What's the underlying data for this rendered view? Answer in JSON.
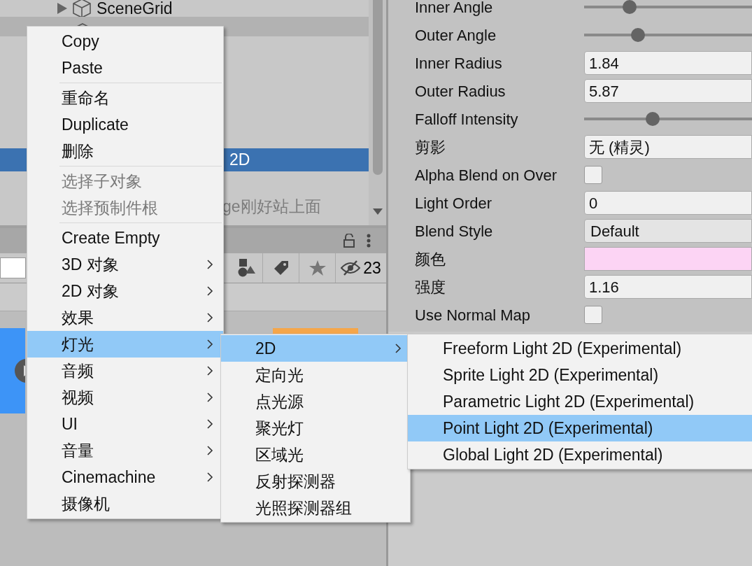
{
  "hierarchy": {
    "items": [
      {
        "name": "SceneGrid",
        "expandable": true,
        "selected": false,
        "disabled": false
      },
      {
        "expandable": false,
        "selected": false,
        "disabled": false
      },
      {
        "name": "2D",
        "expandable": false,
        "selected": true,
        "disabled": false
      },
      {
        "name": "ge刚好站上面",
        "expandable": false,
        "selected": false,
        "disabled": true
      }
    ]
  },
  "project_panel": {
    "hidden_count": "23"
  },
  "inspector": {
    "properties": [
      {
        "kind": "slider",
        "label": "Inner Angle",
        "level": 0.27
      },
      {
        "kind": "slider",
        "label": "Outer Angle",
        "level": 0.32
      },
      {
        "kind": "number",
        "label": "Inner Radius",
        "value": "1.84"
      },
      {
        "kind": "number",
        "label": "Outer Radius",
        "value": "5.87"
      },
      {
        "kind": "slider",
        "label": "Falloff Intensity",
        "level": 0.41
      },
      {
        "kind": "object",
        "label": "剪影",
        "value": "无 (精灵)"
      },
      {
        "kind": "checkbox",
        "label": "Alpha Blend on Over",
        "checked": false
      },
      {
        "kind": "number",
        "label": "Light Order",
        "value": "0"
      },
      {
        "kind": "dropdown",
        "label": "Blend Style",
        "value": "Default"
      },
      {
        "kind": "color",
        "label": "颜色",
        "color": "#fcd4f4"
      },
      {
        "kind": "number",
        "label": "强度",
        "value": "1.16"
      },
      {
        "kind": "checkbox",
        "label": "Use Normal Map",
        "checked": false
      }
    ]
  },
  "context_menu": {
    "items": [
      {
        "kind": "item",
        "label": "Copy",
        "submenu": false,
        "disabled": false,
        "selected": false
      },
      {
        "kind": "item",
        "label": "Paste",
        "submenu": false,
        "disabled": false,
        "selected": false
      },
      {
        "kind": "separator"
      },
      {
        "kind": "item",
        "label": "重命名",
        "submenu": false,
        "disabled": false,
        "selected": false
      },
      {
        "kind": "item",
        "label": "Duplicate",
        "submenu": false,
        "disabled": false,
        "selected": false
      },
      {
        "kind": "item",
        "label": "删除",
        "submenu": false,
        "disabled": false,
        "selected": false
      },
      {
        "kind": "separator"
      },
      {
        "kind": "item",
        "label": "选择子对象",
        "submenu": false,
        "disabled": true,
        "selected": false
      },
      {
        "kind": "item",
        "label": "选择预制件根",
        "submenu": false,
        "disabled": true,
        "selected": false
      },
      {
        "kind": "separator"
      },
      {
        "kind": "item",
        "label": "Create Empty",
        "submenu": false,
        "disabled": false,
        "selected": false
      },
      {
        "kind": "item",
        "label": "3D 对象",
        "submenu": true,
        "disabled": false,
        "selected": false
      },
      {
        "kind": "item",
        "label": "2D 对象",
        "submenu": true,
        "disabled": false,
        "selected": false
      },
      {
        "kind": "item",
        "label": "效果",
        "submenu": true,
        "disabled": false,
        "selected": false
      },
      {
        "kind": "item",
        "label": "灯光",
        "submenu": true,
        "disabled": false,
        "selected": true
      },
      {
        "kind": "item",
        "label": "音频",
        "submenu": true,
        "disabled": false,
        "selected": false
      },
      {
        "kind": "item",
        "label": "视频",
        "submenu": true,
        "disabled": false,
        "selected": false
      },
      {
        "kind": "item",
        "label": "UI",
        "submenu": true,
        "disabled": false,
        "selected": false
      },
      {
        "kind": "item",
        "label": "音量",
        "submenu": true,
        "disabled": false,
        "selected": false
      },
      {
        "kind": "item",
        "label": "Cinemachine",
        "submenu": true,
        "disabled": false,
        "selected": false
      },
      {
        "kind": "item",
        "label": "摄像机",
        "submenu": false,
        "disabled": false,
        "selected": false
      }
    ]
  },
  "light_submenu": {
    "items": [
      {
        "kind": "item",
        "label": "2D",
        "submenu": true,
        "disabled": false,
        "selected": true
      },
      {
        "kind": "item",
        "label": "定向光",
        "submenu": false,
        "disabled": false,
        "selected": false
      },
      {
        "kind": "item",
        "label": "点光源",
        "submenu": false,
        "disabled": false,
        "selected": false
      },
      {
        "kind": "item",
        "label": "聚光灯",
        "submenu": false,
        "disabled": false,
        "selected": false
      },
      {
        "kind": "item",
        "label": "区域光",
        "submenu": false,
        "disabled": false,
        "selected": false
      },
      {
        "kind": "item",
        "label": "反射探测器",
        "submenu": false,
        "disabled": false,
        "selected": false
      },
      {
        "kind": "item",
        "label": "光照探测器组",
        "submenu": false,
        "disabled": false,
        "selected": false
      }
    ]
  },
  "light_2d_submenu": {
    "items": [
      {
        "kind": "item",
        "label": "Freeform Light 2D (Experimental)",
        "submenu": false,
        "disabled": false,
        "selected": false
      },
      {
        "kind": "item",
        "label": "Sprite Light 2D (Experimental)",
        "submenu": false,
        "disabled": false,
        "selected": false
      },
      {
        "kind": "item",
        "label": "Parametric Light 2D (Experimental)",
        "submenu": false,
        "disabled": false,
        "selected": false
      },
      {
        "kind": "item",
        "label": "Point Light 2D (Experimental)",
        "submenu": false,
        "disabled": false,
        "selected": true
      },
      {
        "kind": "item",
        "label": "Global Light 2D (Experimental)",
        "submenu": false,
        "disabled": false,
        "selected": false
      }
    ]
  }
}
